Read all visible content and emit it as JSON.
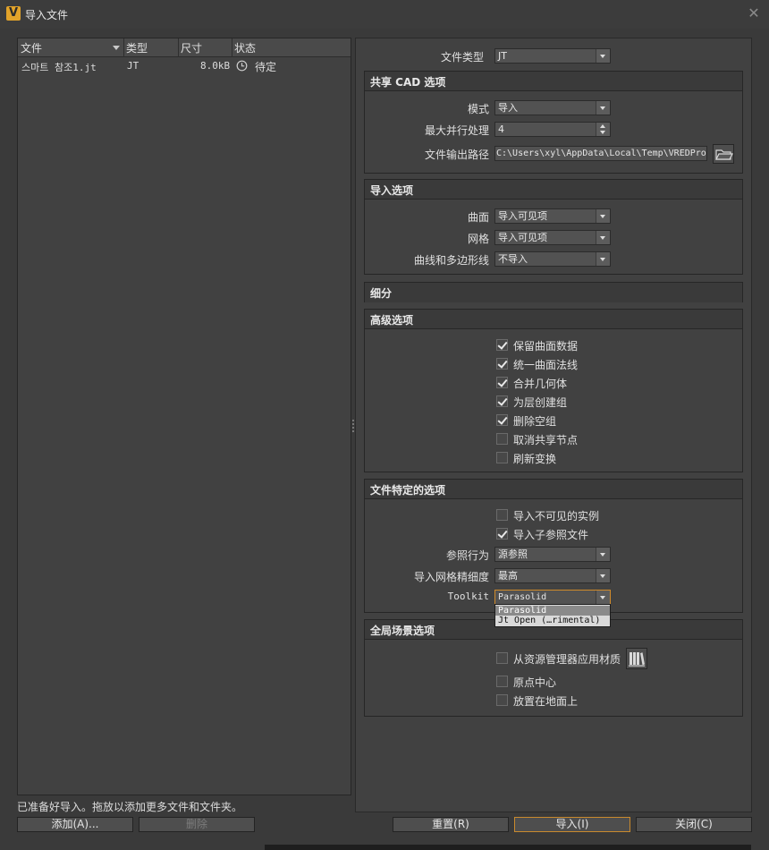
{
  "window": {
    "title": "导入文件",
    "app_icon_letter": "V"
  },
  "file_list": {
    "columns": [
      "文件",
      "类型",
      "尺寸",
      "状态"
    ],
    "rows": [
      {
        "name": "스마트 참조1.jt",
        "type": "JT",
        "size": "8.0kB",
        "status": "待定"
      }
    ]
  },
  "file_type": {
    "label": "文件类型",
    "value": "JT"
  },
  "shared_cad": {
    "title": "共享 CAD 选项",
    "mode_label": "模式",
    "mode_value": "导入",
    "parallel_label": "最大并行处理",
    "parallel_value": "4",
    "output_label": "文件输出路径",
    "output_value": "C:\\Users\\xyl\\AppData\\Local\\Temp\\VREDPro"
  },
  "import_options": {
    "title": "导入选项",
    "surface_label": "曲面",
    "surface_value": "导入可见项",
    "mesh_label": "网格",
    "mesh_value": "导入可见项",
    "curves_label": "曲线和多边形线",
    "curves_value": "不导入"
  },
  "tessellation": {
    "title": "细分"
  },
  "advanced": {
    "title": "高级选项",
    "items": [
      {
        "label": "保留曲面数据",
        "checked": true
      },
      {
        "label": "统一曲面法线",
        "checked": true
      },
      {
        "label": "合并几何体",
        "checked": true
      },
      {
        "label": "为层创建组",
        "checked": true
      },
      {
        "label": "删除空组",
        "checked": true
      },
      {
        "label": "取消共享节点",
        "checked": false
      },
      {
        "label": "刷新变换",
        "checked": false
      }
    ]
  },
  "file_specific": {
    "title": "文件特定的选项",
    "invisible_label": "导入不可见的实例",
    "invisible_checked": false,
    "subref_label": "导入子参照文件",
    "subref_checked": true,
    "ref_behavior_label": "参照行为",
    "ref_behavior_value": "源参照",
    "mesh_precision_label": "导入网格精细度",
    "mesh_precision_value": "最高",
    "toolkit_label": "Toolkit",
    "toolkit_value": "Parasolid",
    "toolkit_options": [
      "Parasolid",
      "Jt Open (…rimental)"
    ]
  },
  "global_scene": {
    "title": "全局场景选项",
    "items": [
      {
        "label": "从资源管理器应用材质",
        "checked": false
      },
      {
        "label": "原点中心",
        "checked": false
      },
      {
        "label": "放置在地面上",
        "checked": false
      }
    ]
  },
  "status_text": "已准备好导入。拖放以添加更多文件和文件夹。",
  "buttons": {
    "add": "添加(A)...",
    "delete": "删除",
    "reset": "重置(R)",
    "import": "导入(I)",
    "close": "关闭(C)"
  },
  "colors": {
    "accent": "#e2a32a",
    "focus_border": "#d08a2a"
  }
}
